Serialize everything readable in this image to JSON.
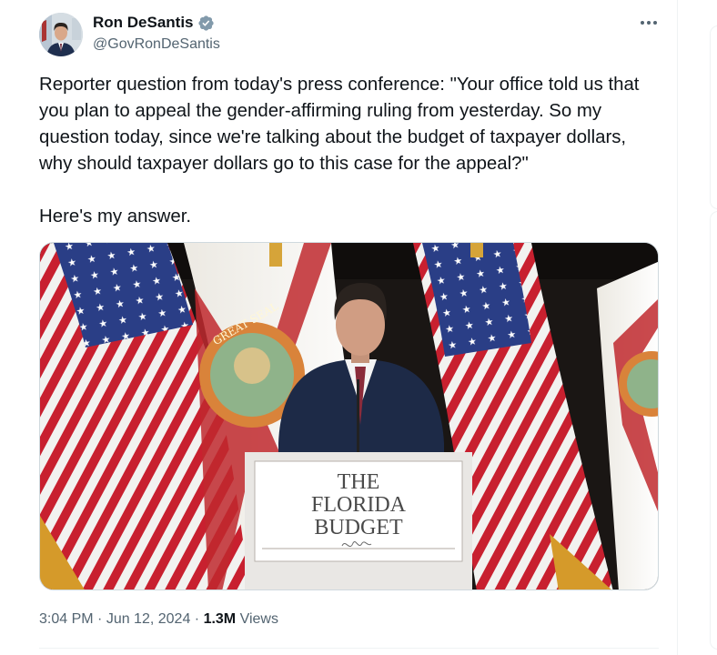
{
  "author": {
    "name": "Ron DeSantis",
    "handle": "@GovRonDeSantis",
    "verified": true,
    "verified_icon": "verified-badge-icon"
  },
  "tweet": {
    "text": "Reporter question from today's press conference: \"Your office told us that you plan to appeal the gender-affirming ruling from yesterday. So my question today, since we're talking about the budget of taxpayer dollars, why should taxpayer dollars go to this case for the appeal?\"\n\nHere's my answer.",
    "media": {
      "kind": "video-still",
      "podium_sign": {
        "line1": "THE",
        "line2": "FLORIDA",
        "line3": "BUDGET"
      }
    }
  },
  "meta": {
    "time": "3:04 PM",
    "sep1": " · ",
    "date": "Jun 12, 2024",
    "sep2": " · ",
    "views_count": "1.3M",
    "views_label": " Views"
  },
  "colors": {
    "text": "#0f1419",
    "secondary": "#536471",
    "verified": "#829aab"
  }
}
